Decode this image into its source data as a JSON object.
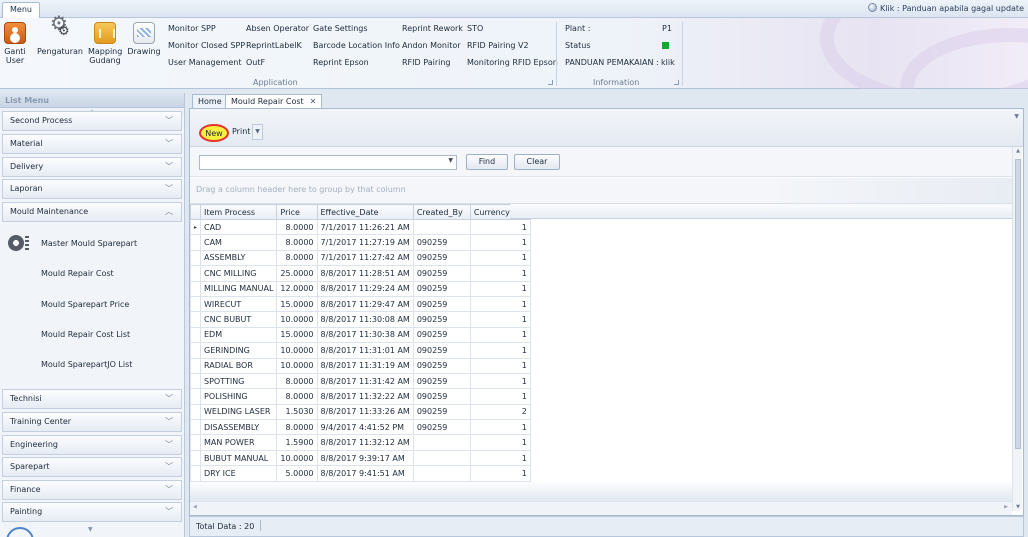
{
  "ribbon": {
    "menu_tab": "Menu",
    "update_link": "Klik : Panduan apabila gagal update",
    "big_buttons": [
      {
        "label": "Ganti\nUser",
        "icon": "user-switch-icon"
      },
      {
        "label": "Pengaturan",
        "icon": "settings-gears-icon"
      },
      {
        "label": "Mapping\nGudang",
        "icon": "warehouse-map-icon"
      },
      {
        "label": "Drawing",
        "icon": "drawing-icon"
      }
    ],
    "application_links": [
      [
        "Monitor SPP",
        "Absen Operator",
        "Gate Settings",
        "Reprint Rework",
        "STO"
      ],
      [
        "Monitor Closed SPP",
        "ReprintLabelK",
        "Barcode Location Info",
        "Andon Monitor",
        "RFID Pairing V2"
      ],
      [
        "User Management",
        "OutF",
        "Reprint Epson",
        "RFID Pairing",
        "Monitoring RFID Epson"
      ]
    ],
    "application_group_label": "Application",
    "information": {
      "plant_label": "Plant :",
      "plant_value": "P1",
      "status_label": "Status",
      "status_color": "#17a62d",
      "guide_label": "PANDUAN PEMAKAIAN :",
      "guide_value": "klik",
      "group_label": "Information"
    }
  },
  "left_panel": {
    "header": "List Menu",
    "items_top": [
      "Second Process",
      "Material",
      "Delivery",
      "Laporan",
      "Mould Maintenance"
    ],
    "mould_maintenance_subitems": [
      "Master Mould Sparepart",
      "Mould Repair Cost",
      "Mould Sparepart Price",
      "Mould Repair Cost List",
      "Mould SparepartJO List"
    ],
    "items_bottom": [
      "Technisi",
      "Training Center",
      "Engineering",
      "Sparepart",
      "Finance",
      "Painting"
    ]
  },
  "tabs": [
    {
      "label": "Home",
      "active": false
    },
    {
      "label": "Mould Repair Cost",
      "active": true
    }
  ],
  "toolbar": {
    "new_label": "New",
    "print_label": "Print"
  },
  "filter": {
    "search_value": "",
    "find_label": "Find",
    "clear_label": "Clear"
  },
  "grid": {
    "group_hint": "Drag a column header here to group by that column",
    "columns": [
      "Item Process",
      "Price",
      "Effective_Date",
      "Created_By",
      "Currency ID"
    ],
    "rows": [
      [
        "CAD",
        "8.0000",
        "7/1/2017 11:26:21 AM",
        "",
        "1"
      ],
      [
        "CAM",
        "8.0000",
        "7/1/2017 11:27:19 AM",
        "090259",
        "1"
      ],
      [
        "ASSEMBLY",
        "8.0000",
        "7/1/2017 11:27:42 AM",
        "090259",
        "1"
      ],
      [
        "CNC MILLING",
        "25.0000",
        "8/8/2017 11:28:51 AM",
        "090259",
        "1"
      ],
      [
        "MILLING MANUAL",
        "12.0000",
        "8/8/2017 11:29:24 AM",
        "090259",
        "1"
      ],
      [
        "WIRECUT",
        "15.0000",
        "8/8/2017 11:29:47 AM",
        "090259",
        "1"
      ],
      [
        "CNC BUBUT",
        "10.0000",
        "8/8/2017 11:30:08 AM",
        "090259",
        "1"
      ],
      [
        "EDM",
        "15.0000",
        "8/8/2017 11:30:38 AM",
        "090259",
        "1"
      ],
      [
        "GERINDING",
        "10.0000",
        "8/8/2017 11:31:01 AM",
        "090259",
        "1"
      ],
      [
        "RADIAL BOR",
        "10.0000",
        "8/8/2017 11:31:19 AM",
        "090259",
        "1"
      ],
      [
        "SPOTTING",
        "8.0000",
        "8/8/2017 11:31:42 AM",
        "090259",
        "1"
      ],
      [
        "POLISHING",
        "8.0000",
        "8/8/2017 11:32:22 AM",
        "090259",
        "1"
      ],
      [
        "WELDING LASER",
        "1.5030",
        "8/8/2017 11:33:26 AM",
        "090259",
        "2"
      ],
      [
        "DISASSEMBLY",
        "8.0000",
        "9/4/2017 4:41:52 PM",
        "090259",
        "1"
      ],
      [
        "MAN POWER",
        "1.5900",
        "8/8/2017 11:32:12 AM",
        "",
        "1"
      ],
      [
        "BUBUT MANUAL",
        "10.0000",
        "8/8/2017 9:39:17 AM",
        "",
        "1"
      ],
      [
        "DRY ICE",
        "5.0000",
        "8/8/2017 9:41:51 AM",
        "",
        "1"
      ]
    ]
  },
  "status_bar": {
    "total_label": "Total Data : 20"
  }
}
